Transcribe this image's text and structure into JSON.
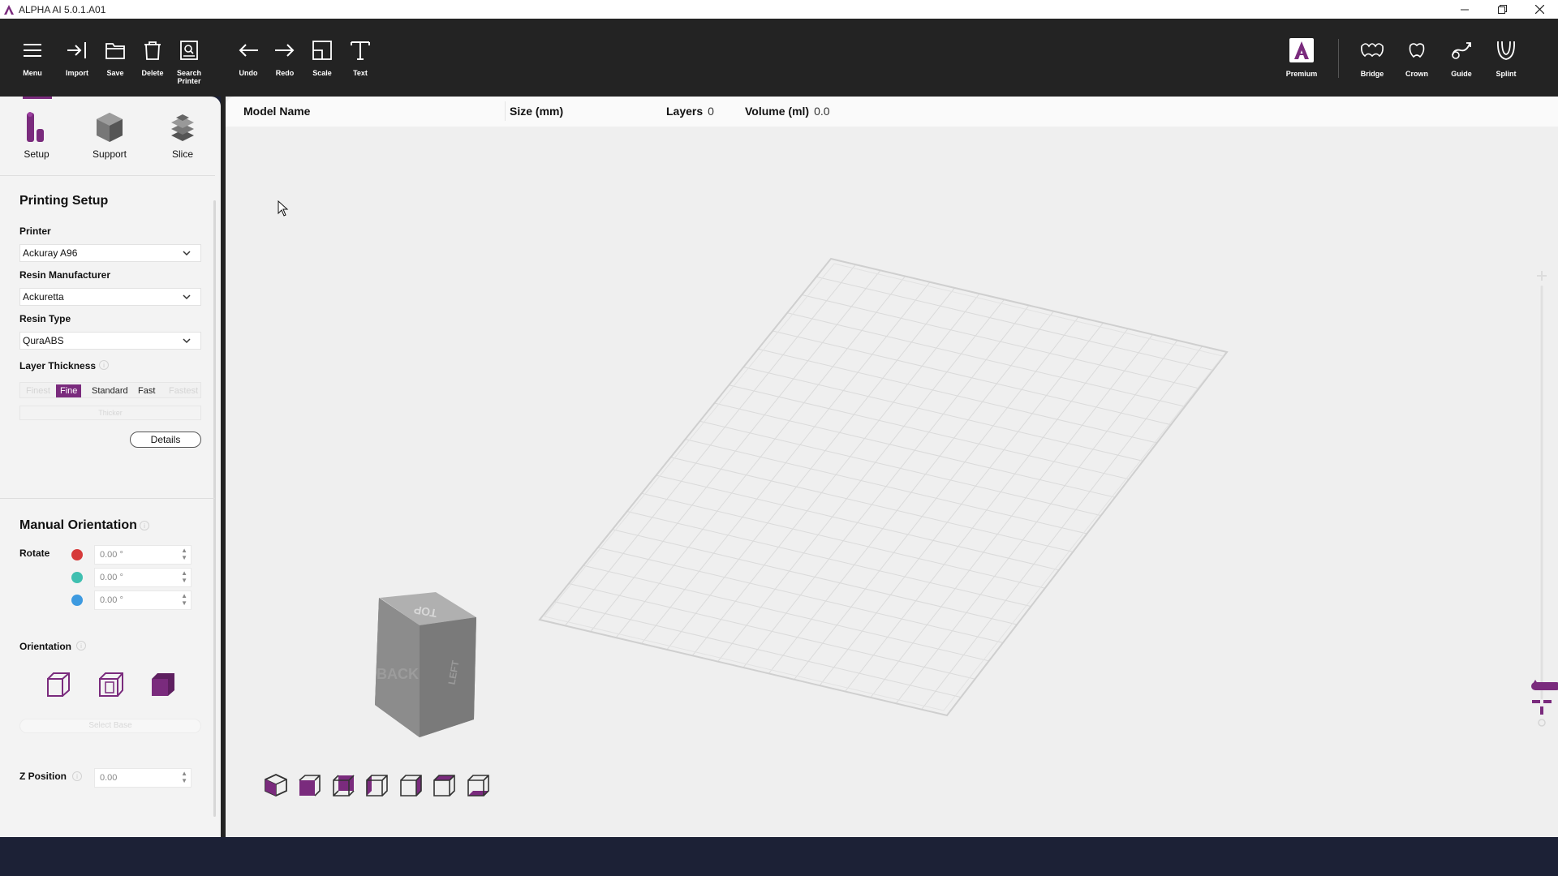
{
  "window": {
    "title": "ALPHA AI 5.0.1.A01",
    "brand_color": "#7a2b7d"
  },
  "toolbar": {
    "left": [
      {
        "label": "Menu",
        "icon": "hamburger-icon"
      },
      {
        "label": "Import",
        "icon": "import-icon"
      },
      {
        "label": "Save",
        "icon": "folder-icon"
      },
      {
        "label": "Delete",
        "icon": "trash-icon"
      },
      {
        "label": "Search Printer",
        "icon": "search-printer-icon"
      },
      {
        "label": "Undo",
        "icon": "undo-arrow-icon"
      },
      {
        "label": "Redo",
        "icon": "redo-arrow-icon"
      },
      {
        "label": "Scale",
        "icon": "scale-icon"
      },
      {
        "label": "Text",
        "icon": "text-icon"
      }
    ],
    "right": [
      {
        "label": "Premium",
        "icon": "premium-logo-icon"
      },
      {
        "label": "Bridge",
        "icon": "bridge-icon"
      },
      {
        "label": "Crown",
        "icon": "crown-icon"
      },
      {
        "label": "Guide",
        "icon": "guide-icon"
      },
      {
        "label": "Splint",
        "icon": "splint-icon"
      }
    ]
  },
  "steps": [
    {
      "label": "Setup",
      "icon": "setup-icon",
      "active": true
    },
    {
      "label": "Support",
      "icon": "support-icon"
    },
    {
      "label": "Slice",
      "icon": "slice-icon"
    }
  ],
  "printing_setup": {
    "title": "Printing Setup",
    "printer_label": "Printer",
    "printer_value": "Ackuray A96",
    "resin_manufacturer_label": "Resin Manufacturer",
    "resin_manufacturer_value": "Ackuretta",
    "resin_type_label": "Resin Type",
    "resin_type_value": "QuraABS",
    "layer_thickness_label": "Layer Thickness",
    "layer_options": [
      "Finest",
      "Fine",
      "Standard",
      "Fast",
      "Fastest"
    ],
    "layer_selected": "Fine",
    "layer_desc": "Thicker",
    "details_button": "Details"
  },
  "manual_orientation": {
    "title": "Manual Orientation",
    "rotate_label": "Rotate",
    "rotate_values": [
      "0.00 °",
      "0.00 °",
      "0.00 °"
    ],
    "axis_colors": [
      "#d63a3a",
      "#3fbfb0",
      "#3d9ae0"
    ],
    "orientation_label": "Orientation",
    "select_base": "Select Base",
    "z_position_label": "Z Position",
    "z_position_value": "0.00"
  },
  "info_bar": {
    "model_name_label": "Model Name",
    "size_label": "Size (mm)",
    "layers_label": "Layers",
    "layers_value": "0",
    "volume_label": "Volume (ml)",
    "volume_value": "0.0"
  },
  "view_cube": {
    "top": "TOP",
    "back": "BACK",
    "left": "LEFT"
  },
  "view_buttons": [
    "iso-view-icon",
    "front-view-icon",
    "back-view-icon",
    "left-view-icon",
    "right-view-icon",
    "top-view-icon",
    "bottom-view-icon"
  ]
}
